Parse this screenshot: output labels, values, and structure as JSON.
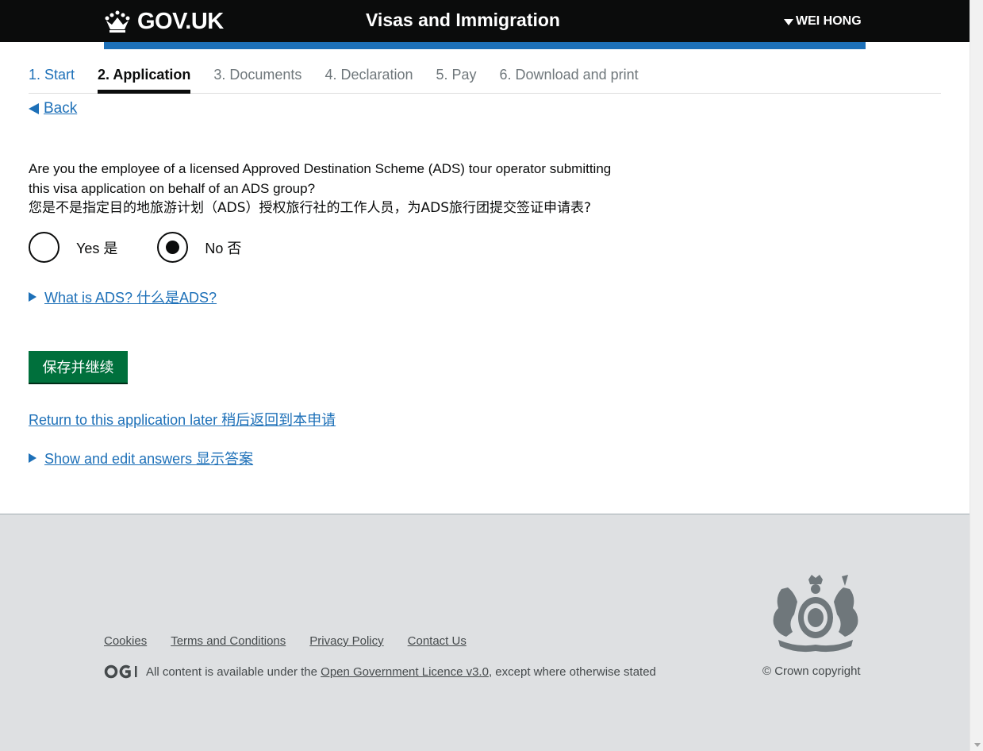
{
  "header": {
    "logo_text": "GOV.UK",
    "service_name": "Visas and Immigration",
    "user_name": "WEI HONG"
  },
  "steps": [
    {
      "label": "1. Start",
      "state": "done"
    },
    {
      "label": "2. Application",
      "state": "active"
    },
    {
      "label": "3. Documents",
      "state": "todo"
    },
    {
      "label": "4. Declaration",
      "state": "todo"
    },
    {
      "label": "5. Pay",
      "state": "todo"
    },
    {
      "label": "6. Download and print",
      "state": "todo"
    }
  ],
  "back_label": "Back",
  "question": {
    "line1": "Are you the employee of a licensed Approved Destination Scheme (ADS) tour operator submitting",
    "line2": "this visa application on behalf of an ADS group?",
    "line_zh": "您是不是指定目的地旅游计划（ADS）授权旅行社的工作人员，为ADS旅行团提交签证申请表?"
  },
  "options": {
    "yes": "Yes 是",
    "no": "No 否",
    "selected": "no"
  },
  "what_is_ads": "What is ADS? 什么是ADS? ",
  "continue_button": "保存并继续",
  "return_link": "Return to this application later 稍后返回到本申请",
  "show_answers": "Show and edit answers 显示答案",
  "footer": {
    "links": [
      "Cookies",
      "Terms and Conditions",
      "Privacy Policy",
      "Contact Us"
    ],
    "licence_prefix": "All content is available under the ",
    "licence_link": "Open Government Licence v3.0",
    "licence_suffix": ", except where otherwise stated",
    "copyright": "© Crown copyright"
  },
  "colors": {
    "header_bg": "#0b0c0c",
    "blue_bar": "#1d70b8",
    "link": "#1d70b8",
    "button": "#00703c",
    "footer_bg": "#dee0e2"
  }
}
